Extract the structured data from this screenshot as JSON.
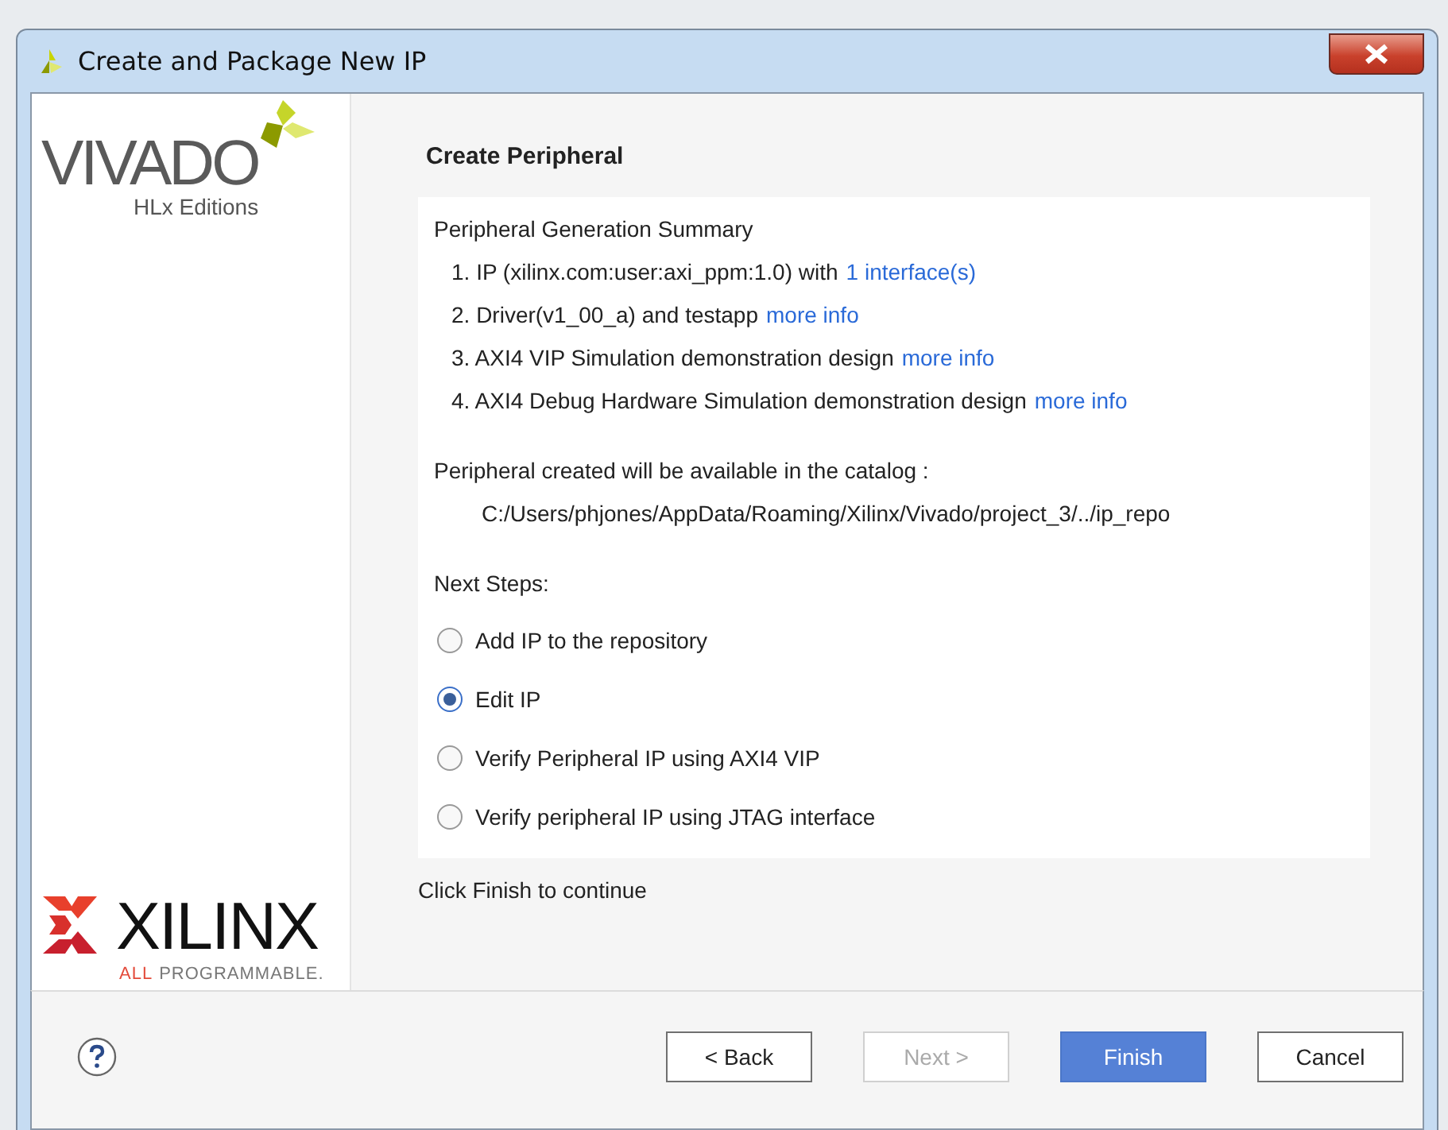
{
  "window": {
    "title": "Create and Package New IP"
  },
  "branding": {
    "product": "VIVADO",
    "edition": "HLx Editions",
    "company": "XILINX",
    "tagline_accent": "ALL",
    "tagline": "PROGRAMMABLE."
  },
  "page": {
    "heading": "Create Peripheral",
    "summary_title": "Peripheral Generation Summary",
    "summary_items": [
      {
        "text": "1. IP (xilinx.com:user:axi_ppm:1.0) with",
        "link": "1 interface(s)"
      },
      {
        "text": "2. Driver(v1_00_a) and testapp",
        "link": "more info"
      },
      {
        "text": "3. AXI4 VIP Simulation demonstration design",
        "link": "more info"
      },
      {
        "text": "4. AXI4 Debug Hardware Simulation demonstration design",
        "link": "more info"
      }
    ],
    "catalog_note": "Peripheral created will be available in the catalog :",
    "catalog_path": "C:/Users/phjones/AppData/Roaming/Xilinx/Vivado/project_3/../ip_repo",
    "next_steps_label": "Next Steps:",
    "options": [
      {
        "label": "Add IP to the repository",
        "selected": false
      },
      {
        "label": "Edit IP",
        "selected": true
      },
      {
        "label": "Verify Peripheral IP using AXI4 VIP",
        "selected": false
      },
      {
        "label": "Verify peripheral IP using JTAG interface",
        "selected": false
      }
    ],
    "footer_note": "Click Finish to continue"
  },
  "buttons": [
    {
      "label": "< Back",
      "kind": "normal",
      "disabled": false
    },
    {
      "label": "Next >",
      "kind": "normal",
      "disabled": true
    },
    {
      "label": "Finish",
      "kind": "primary",
      "disabled": false
    },
    {
      "label": "Cancel",
      "kind": "normal",
      "disabled": false
    }
  ]
}
